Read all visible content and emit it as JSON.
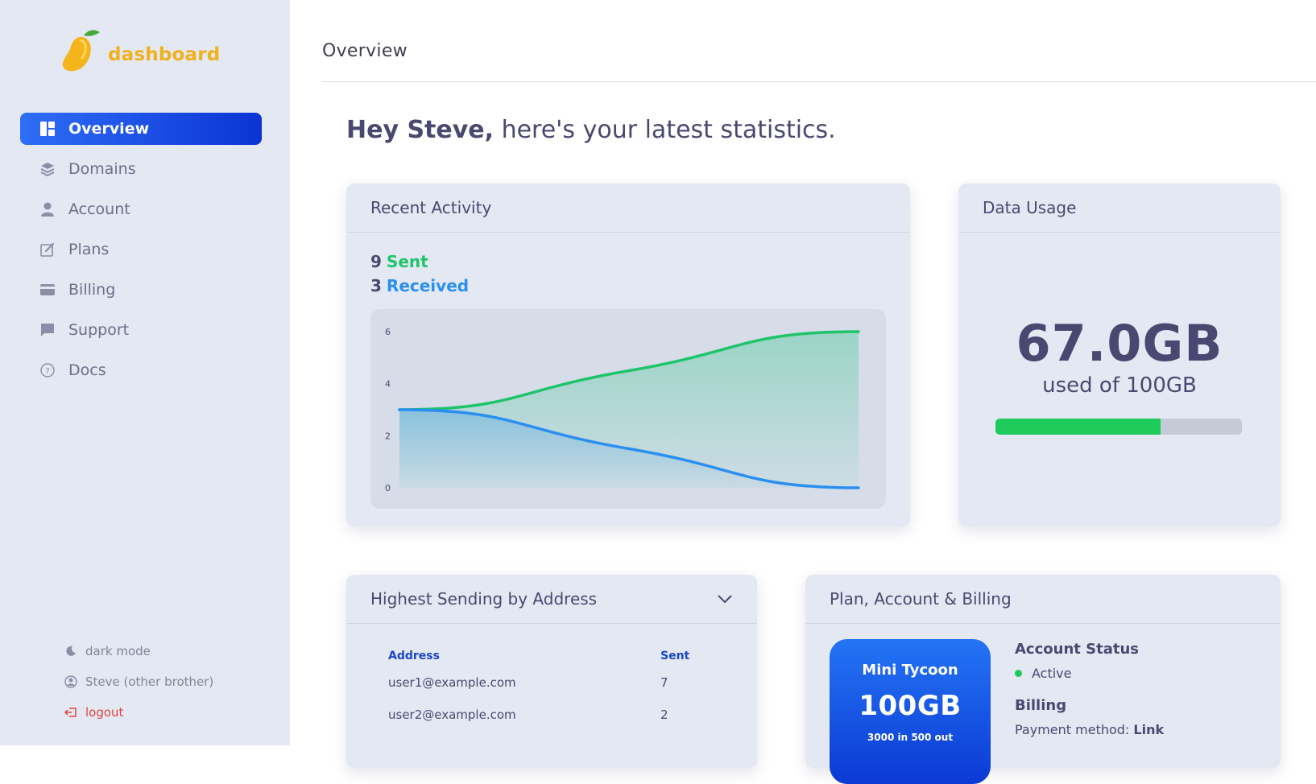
{
  "brand": {
    "name": "dashboard",
    "color": "#f0b11c"
  },
  "sidebar": {
    "items": [
      {
        "label": "Overview",
        "icon": "dashboard-grid-icon",
        "active": true
      },
      {
        "label": "Domains",
        "icon": "layers-icon",
        "active": false
      },
      {
        "label": "Account",
        "icon": "user-icon",
        "active": false
      },
      {
        "label": "Plans",
        "icon": "edit-icon",
        "active": false
      },
      {
        "label": "Billing",
        "icon": "credit-card-icon",
        "active": false
      },
      {
        "label": "Support",
        "icon": "chat-icon",
        "active": false
      },
      {
        "label": "Docs",
        "icon": "help-circle-icon",
        "active": false
      }
    ],
    "bottom": {
      "dark_mode": "dark mode",
      "user": "Steve (other brother)",
      "logout": "logout"
    }
  },
  "header": {
    "title": "Overview"
  },
  "greeting": {
    "name": "Hey Steve,",
    "rest": " here's your latest statistics."
  },
  "activity": {
    "title": "Recent Activity",
    "sent_count": "9",
    "sent_label": "Sent",
    "received_count": "3",
    "received_label": "Received"
  },
  "chart_data": {
    "type": "area",
    "title": "",
    "xlabel": "",
    "ylabel": "",
    "ylim": [
      0,
      6
    ],
    "yticks": [
      "0",
      "2",
      "4",
      "6"
    ],
    "x": [
      0,
      1,
      2
    ],
    "series": [
      {
        "values": [
          3,
          4.5,
          6
        ],
        "color": "#1fc46a"
      },
      {
        "values": [
          3,
          1.5,
          0
        ],
        "color": "#2a8ff0"
      }
    ],
    "grid": false
  },
  "usage": {
    "title": "Data Usage",
    "amount": "67.0GB",
    "subtitle": "used of 100GB",
    "fraction": 0.67,
    "fill_color": "#1ecb5a"
  },
  "sending": {
    "title": "Highest Sending by Address",
    "columns": [
      "Address",
      "Sent"
    ],
    "rows": [
      [
        "user1@example.com",
        "7"
      ],
      [
        "user2@example.com",
        "2"
      ]
    ]
  },
  "plan": {
    "title": "Plan, Account & Billing",
    "name": "Mini Tycoon",
    "size": "100GB",
    "limit": "3000 in 500 out",
    "status_label": "Account Status",
    "status_value": "Active",
    "billing_label": "Billing",
    "payment_prefix": "Payment method: ",
    "payment_value": "Link"
  }
}
